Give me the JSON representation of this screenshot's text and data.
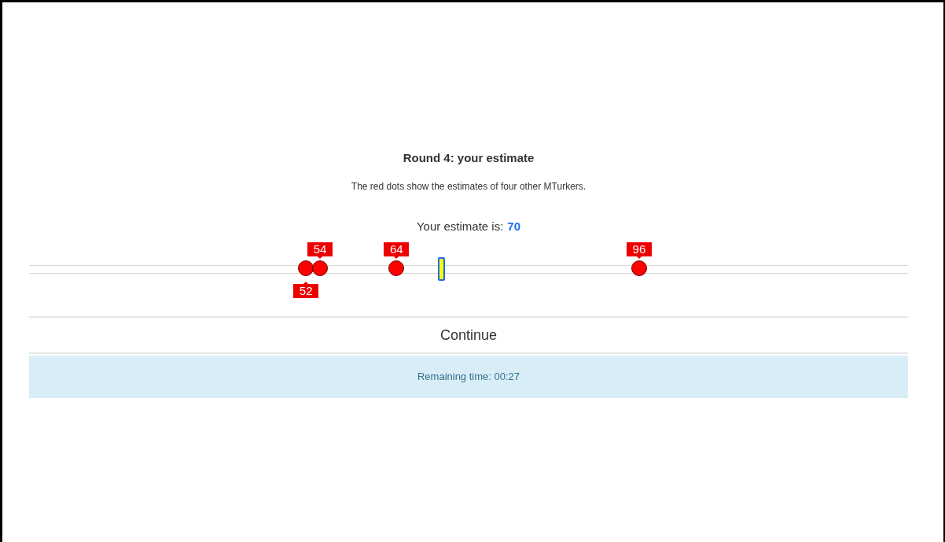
{
  "title": "Round 4: your estimate",
  "description": "The red dots show the estimates of four other MTurkers.",
  "estimate": {
    "label": "Your estimate is:",
    "value": "70"
  },
  "slider": {
    "level": 0.469,
    "others": [
      {
        "label": "52",
        "level": 0.315,
        "kind": "below"
      },
      {
        "label": "54",
        "level": 0.331,
        "kind": "above"
      },
      {
        "label": "64",
        "level": 0.418,
        "kind": "above"
      },
      {
        "label": "96",
        "level": 0.694,
        "kind": "above"
      }
    ]
  },
  "continue_button": "Continue",
  "timer": "Remaining time: 00:27"
}
